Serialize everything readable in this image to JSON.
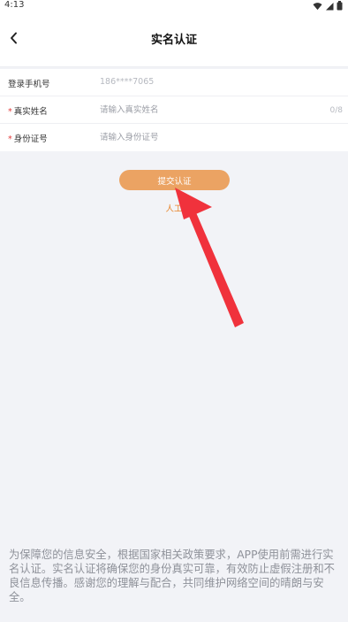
{
  "status_bar": {
    "time": "4:13"
  },
  "header": {
    "title": "实名认证"
  },
  "form": {
    "phone": {
      "label": "登录手机号",
      "value": "186****7065"
    },
    "name": {
      "label": "真实姓名",
      "placeholder": "请输入真实姓名",
      "counter": "0/8",
      "required": "*"
    },
    "id_number": {
      "label": "身份证号",
      "placeholder": "请输入身份证号",
      "required": "*"
    }
  },
  "submit": {
    "label": "提交认证"
  },
  "manual": {
    "label": "人工"
  },
  "notice": {
    "text": "为保障您的信息安全，根据国家相关政策要求，APP使用前需进行实名认证。实名认证将确保您的身份真实可靠，有效防止虚假注册和不良信息传播。感谢您的理解与配合，共同维护网络空间的晴朗与安全。"
  },
  "colors": {
    "accent": "#eba363",
    "link": "#e8862d",
    "required": "#e23c3c",
    "arrow": "#f0323c"
  },
  "icons": {
    "back": "chevron-left-icon",
    "wifi": "wifi-icon",
    "signal": "signal-icon",
    "battery": "battery-icon"
  }
}
